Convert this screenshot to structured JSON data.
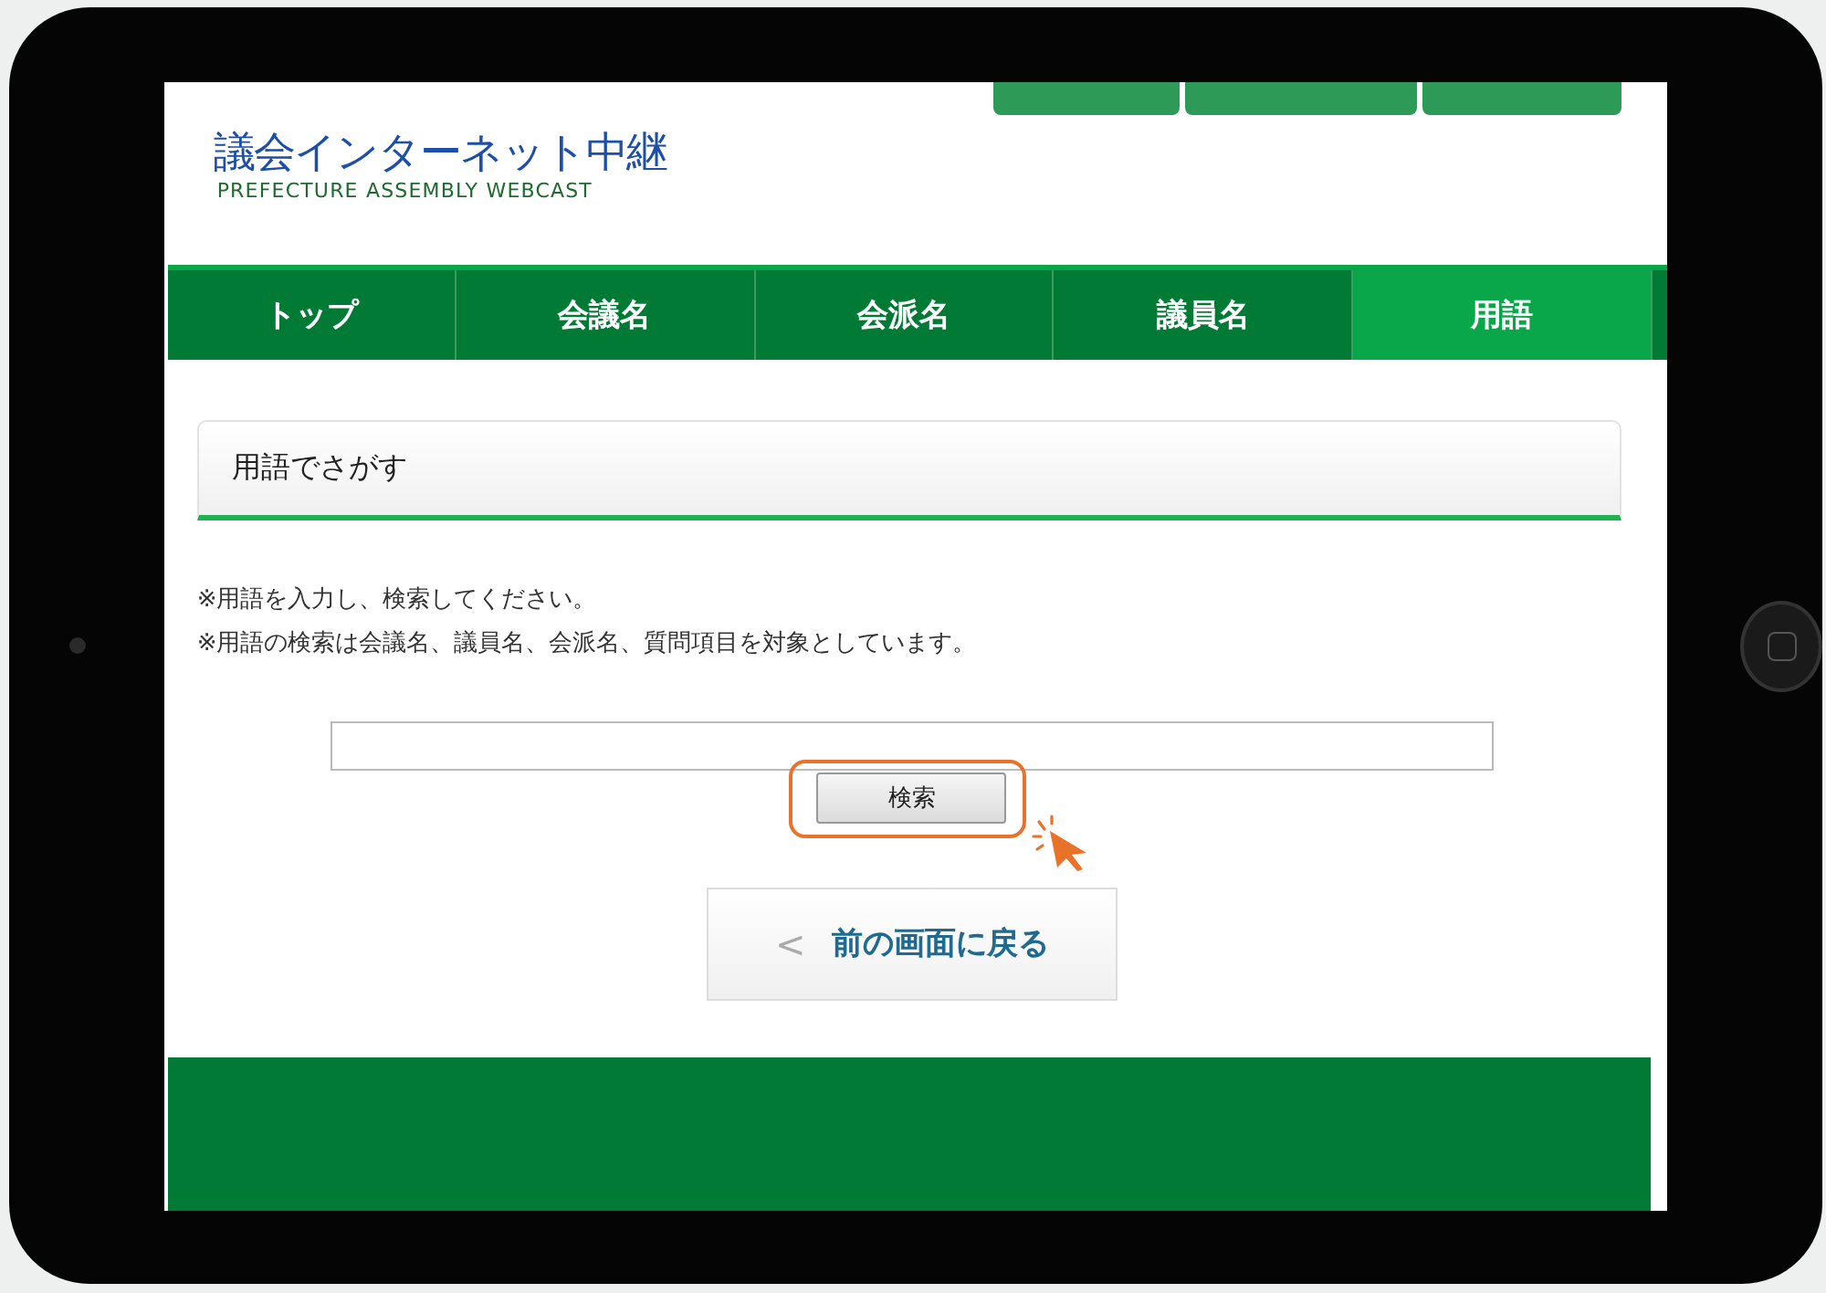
{
  "site": {
    "title": "議会インターネット中継",
    "subtitle": "PREFECTURE ASSEMBLY WEBCAST"
  },
  "nav": [
    {
      "label": "トップ",
      "selected": false
    },
    {
      "label": "会議名",
      "selected": false
    },
    {
      "label": "会派名",
      "selected": false
    },
    {
      "label": "議員名",
      "selected": false
    },
    {
      "label": "用語",
      "selected": true
    }
  ],
  "section": {
    "heading": "用語でさがす"
  },
  "notes": [
    "※用語を入力し、検索してください。",
    "※用語の検索は会議名、議員名、会派名、質問項目を対象としています。"
  ],
  "search": {
    "button": "検索",
    "highlighted": true
  },
  "back_button": {
    "icon": "<",
    "label": "前の画面に戻る"
  }
}
